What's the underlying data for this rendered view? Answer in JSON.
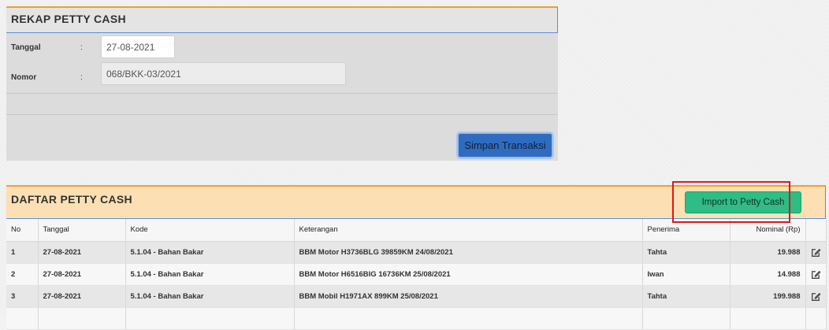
{
  "rekap": {
    "title": "REKAP PETTY CASH",
    "tanggal_label": "Tanggal",
    "tanggal_value": "27-08-2021",
    "nomor_label": "Nomor",
    "nomor_value": "068/BKK-03/2021",
    "colon": ":",
    "save_label": "Simpan Transaksi"
  },
  "daftar": {
    "title": "DAFTAR PETTY CASH",
    "import_label": "Import to Petty Cash",
    "columns": [
      "No",
      "Tanggal",
      "Kode",
      "Keterangan",
      "Penerima",
      "Nominal (Rp)",
      ""
    ],
    "rows": [
      {
        "no": "1",
        "tanggal": "27-08-2021",
        "kode": "5.1.04 - Bahan Bakar",
        "keterangan": "BBM Motor H3736BLG 39859KM 24/08/2021",
        "penerima": "Tahta",
        "nominal": "19.988",
        "action_icon": "edit-icon"
      },
      {
        "no": "2",
        "tanggal": "27-08-2021",
        "kode": "5.1.04 - Bahan Bakar",
        "keterangan": "BBM Motor H6516BIG 16736KM 25/08/2021",
        "penerima": "Iwan",
        "nominal": "14.988",
        "action_icon": "edit-icon"
      },
      {
        "no": "3",
        "tanggal": "27-08-2021",
        "kode": "5.1.04 - Bahan Bakar",
        "keterangan": "BBM Mobil H1971AX 899KM 25/08/2021",
        "penerima": "Tahta",
        "nominal": "199.988",
        "action_icon": "edit-icon"
      }
    ]
  },
  "colors": {
    "header_accent": "#f0a030",
    "panel_border": "#5b8fd6",
    "save_button": "#2f6cc0",
    "import_button": "#2dbd85",
    "highlight": "#e0161a"
  }
}
